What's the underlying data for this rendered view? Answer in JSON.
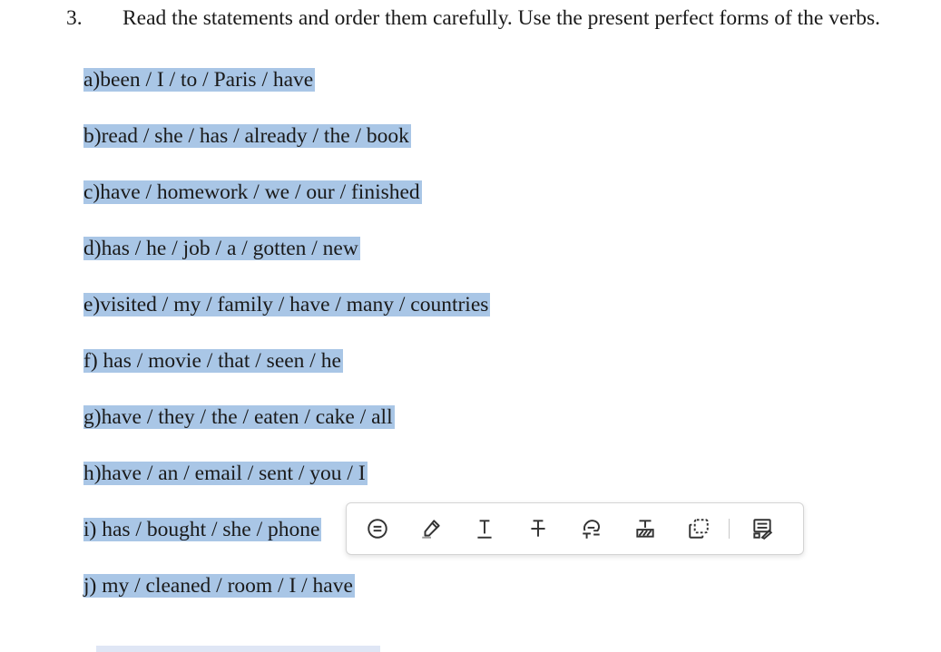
{
  "instruction": {
    "number": "3.",
    "text": "Read the statements and order them carefully. Use the present perfect forms of the verbs."
  },
  "items": [
    {
      "label": "a)",
      "text": "been / I / to / Paris / have"
    },
    {
      "label": "b)",
      "text": "read / she / has / already / the / book"
    },
    {
      "label": "c)",
      "text": "have / homework / we / our / finished"
    },
    {
      "label": "d)",
      "text": "has / he / job / a / gotten / new"
    },
    {
      "label": "e)",
      "text": "visited / my / family / have / many / countries"
    },
    {
      "label": "f)",
      "text": " has / movie / that / seen / he"
    },
    {
      "label": "g)",
      "text": "have / they / the / eaten / cake / all"
    },
    {
      "label": "h)",
      "text": "have / an / email / sent / you / I"
    },
    {
      "label": "i)",
      "text": " has / bought / she / phone"
    },
    {
      "label": "j)",
      "text": " my / cleaned / room / I / have"
    }
  ],
  "colors": {
    "highlight": "#a9c6e6",
    "icon": "#333333"
  },
  "toolbar": {
    "icons": [
      "comment-icon",
      "highlighter-icon",
      "underline-icon",
      "strikethrough-icon",
      "replace-text-icon",
      "insert-text-icon",
      "area-select-icon",
      "notes-icon"
    ]
  }
}
